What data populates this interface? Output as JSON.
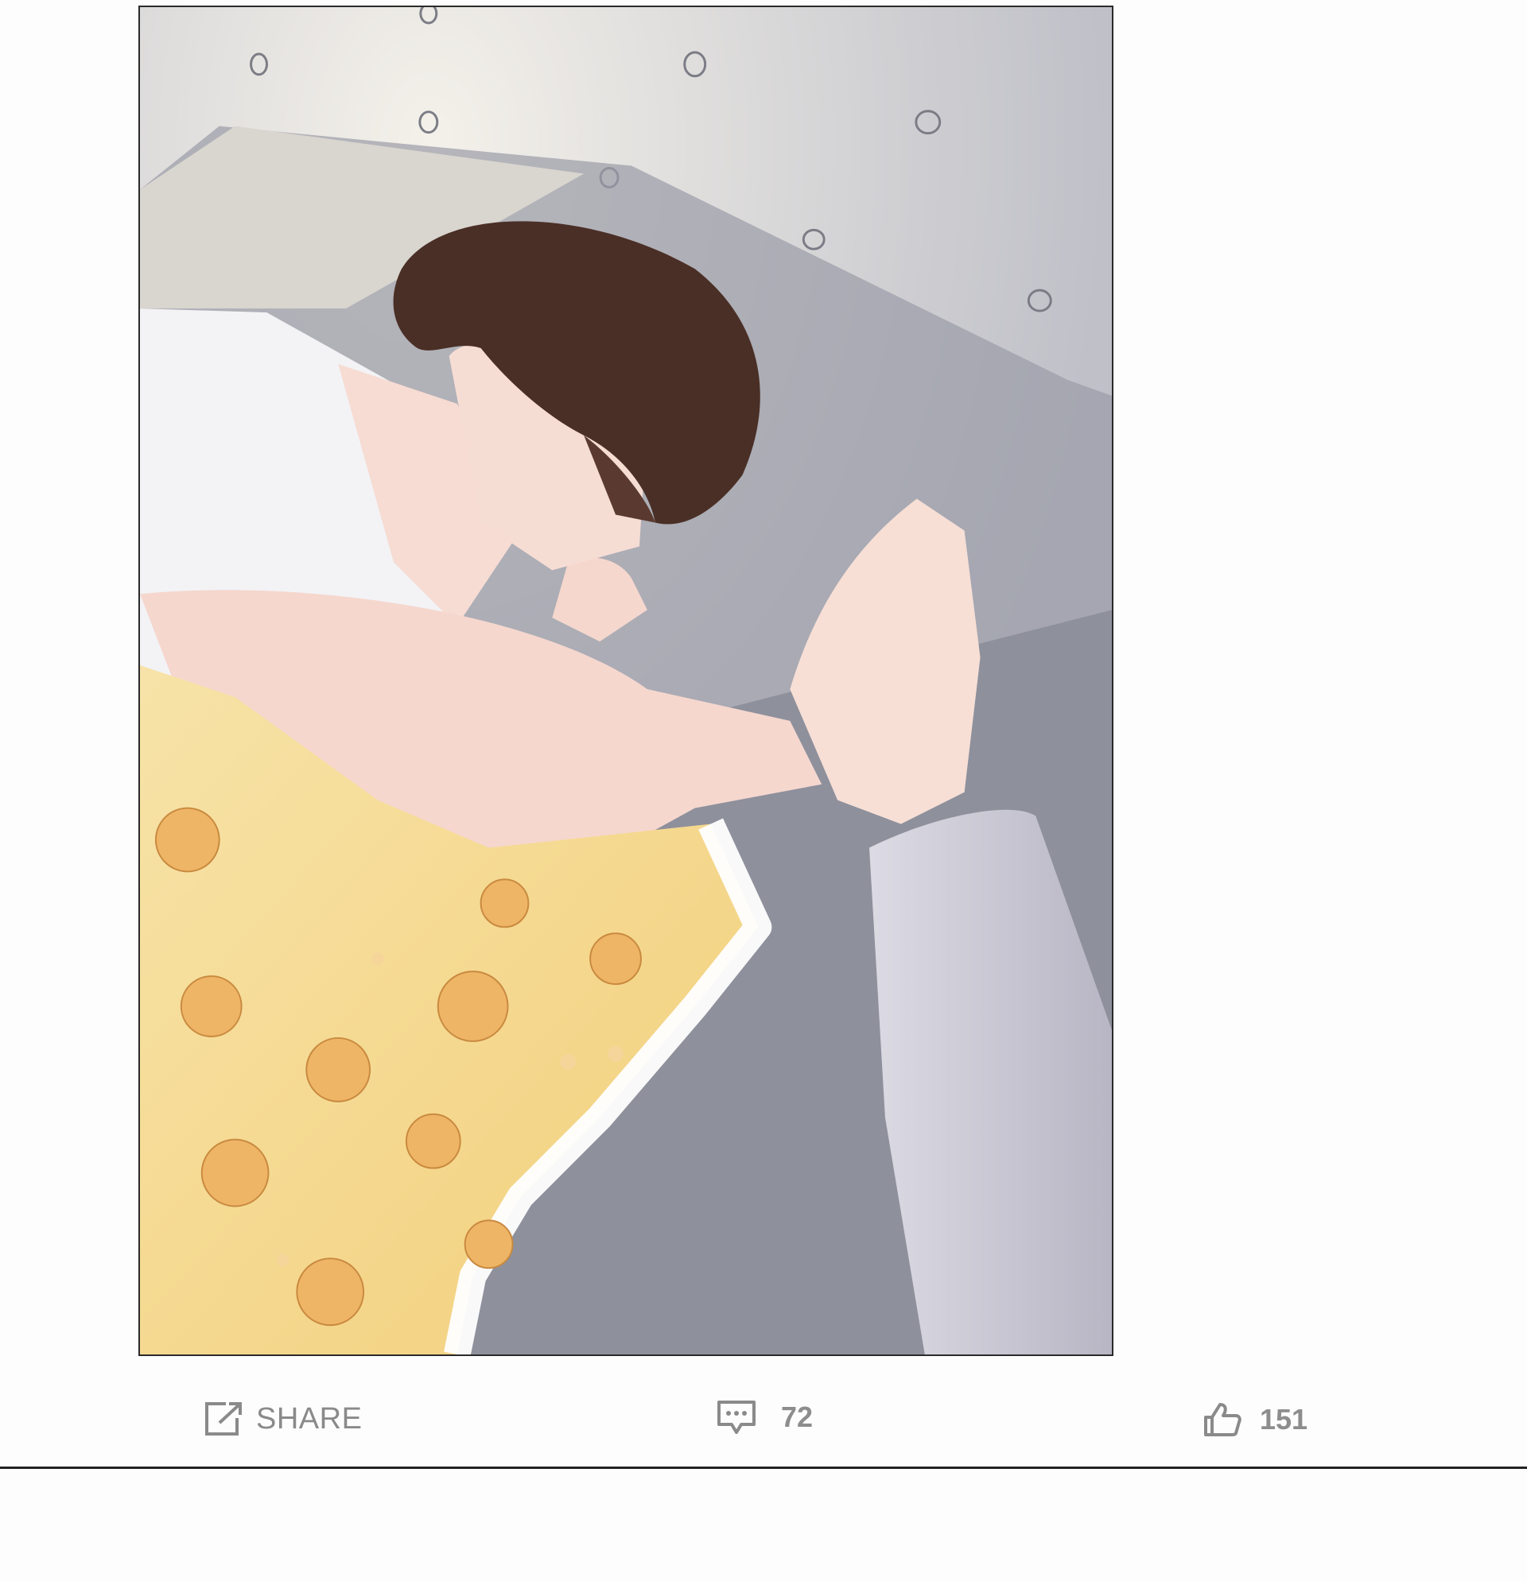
{
  "panel": {
    "image_description_icon": "comic-panel"
  },
  "actions": {
    "share_label": "SHARE",
    "share_icon": "share-icon",
    "comment_count": "72",
    "comment_icon": "comment-icon",
    "like_count": "151",
    "like_icon": "thumbs-up-icon"
  },
  "colors": {
    "background": "#fdfdfd",
    "action_text": "#8a8a8a",
    "divider": "#222222"
  }
}
